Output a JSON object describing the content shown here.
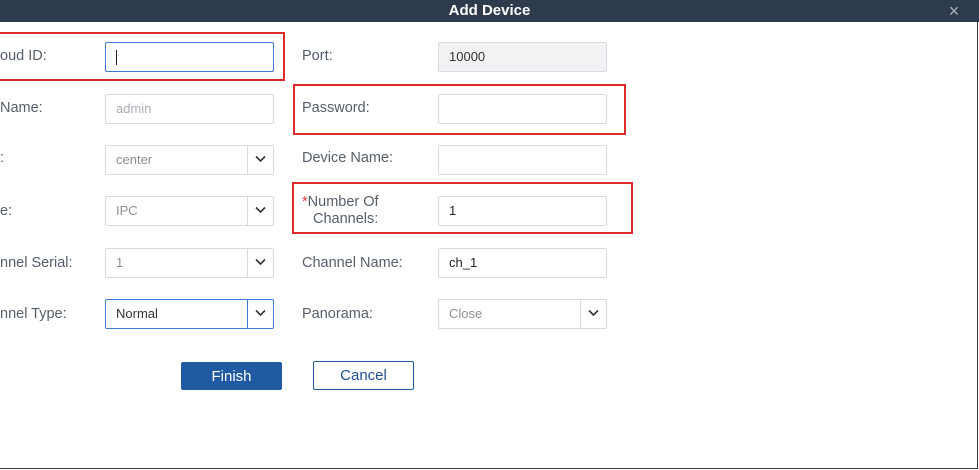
{
  "dialog": {
    "title": "Add Device",
    "close_glyph": "×"
  },
  "fields": {
    "cloud_id": {
      "label": "oud ID:",
      "value": ""
    },
    "port": {
      "label": "Port:",
      "value": "10000"
    },
    "user_name": {
      "label": "Name:",
      "placeholder": "admin"
    },
    "password": {
      "label": "Password:",
      "value": ""
    },
    "group": {
      "label": ":",
      "value": "center"
    },
    "device_name": {
      "label": "Device Name:",
      "value": ""
    },
    "device_type": {
      "label": "e:",
      "value": "IPC"
    },
    "number_of_channels": {
      "required_mark": "*",
      "label_line1": "Number Of",
      "label_line2": "Channels:",
      "value": "1"
    },
    "channel_serial": {
      "label": "nnel Serial:",
      "value": "1"
    },
    "channel_name": {
      "label": "Channel Name:",
      "value": "ch_1"
    },
    "channel_type": {
      "label": "nnel Type:",
      "value": "Normal"
    },
    "panorama": {
      "label": "Panorama:",
      "value": "Close"
    }
  },
  "buttons": {
    "finish": "Finish",
    "cancel": "Cancel"
  },
  "colors": {
    "titlebar": "#2d3b4c",
    "primary": "#1f5aa3",
    "highlight": "#dc2b2b",
    "focus": "#3d7ad3"
  }
}
